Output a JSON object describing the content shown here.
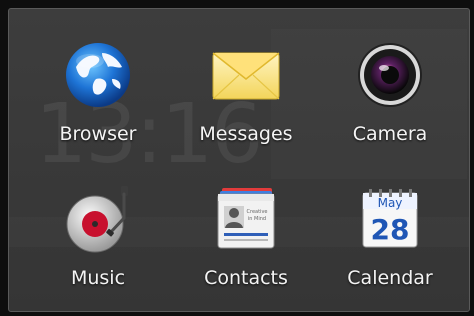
{
  "apps": [
    {
      "label": "Browser",
      "icon": "globe-icon"
    },
    {
      "label": "Messages",
      "icon": "envelope-icon"
    },
    {
      "label": "Camera",
      "icon": "camera-lens-icon"
    },
    {
      "label": "Music",
      "icon": "turntable-icon"
    },
    {
      "label": "Contacts",
      "icon": "contact-card-icon"
    },
    {
      "label": "Calendar",
      "icon": "calendar-icon"
    }
  ],
  "contacts_icon_text": "Creative in Mind",
  "calendar_icon": {
    "month": "May",
    "day": "28"
  },
  "colors": {
    "folder_bg": "#3a3a3a",
    "folder_border": "#5a5a5a",
    "label": "#f4f4f4"
  }
}
